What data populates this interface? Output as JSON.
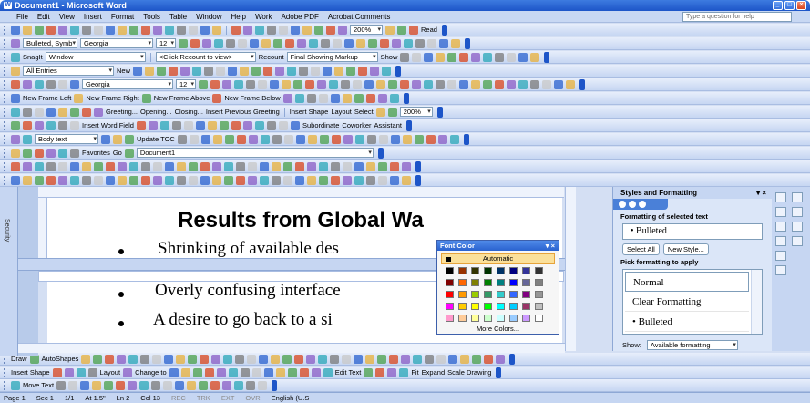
{
  "window": {
    "title": "Document1 - Microsoft Word"
  },
  "menu": [
    "File",
    "Edit",
    "View",
    "Insert",
    "Format",
    "Tools",
    "Table",
    "Window",
    "Help",
    "Work",
    "Adobe PDF",
    "Acrobat Comments"
  ],
  "ask_placeholder": "Type a question for help",
  "toolbars": {
    "standard": {
      "zoom": "200%",
      "read_label": "Read"
    },
    "formatting": {
      "style": "Bulleted, Symb",
      "font": "Georgia",
      "size": "12"
    },
    "snagit": {
      "snagit_label": "SnagIt",
      "capture_target": "Window"
    },
    "reviewing": {
      "recount": "<Click Recount to view>",
      "recount_btn": "Recount",
      "markup": "Final Showing Markup",
      "show": "Show"
    },
    "autotext": {
      "entries": "All Entries",
      "new": "New"
    },
    "format2": {
      "font": "Georgia",
      "size": "12"
    },
    "frames": {
      "items": [
        "New Frame Left",
        "New Frame Right",
        "New Frame Above",
        "New Frame Below"
      ]
    },
    "mail": {
      "items": [
        "Greeting...",
        "Opening...",
        "Closing...",
        "Insert Previous Greeting"
      ],
      "insert_shape": "Insert Shape",
      "layout": "Layout",
      "select": "Select",
      "zoom": "200%"
    },
    "fields": {
      "insert_word_field": "Insert Word Field",
      "subordinate": "Subordinate",
      "coworker": "Coworker",
      "assistant": "Assistant"
    },
    "outline": {
      "style": "Body text",
      "update_toc": "Update TOC"
    },
    "web": {
      "favorites": "Favorites",
      "go": "Go",
      "address": "Document1"
    },
    "drawing": {
      "draw": "Draw",
      "autoshapes": "AutoShapes"
    },
    "org": {
      "insert_shape": "Insert Shape",
      "layout": "Layout",
      "change_to": "Change to",
      "edit_text": "Edit Text",
      "fit": "Fit",
      "expand": "Expand",
      "scale": "Scale Drawing"
    },
    "movetext": "Move Text"
  },
  "document": {
    "heading": "Results from Global Wa",
    "bullets": [
      "Shrinking of available des",
      "Overly confusing interface",
      "A desire to go back to a si"
    ]
  },
  "font_color_popup": {
    "title": "Font Color",
    "automatic": "Automatic",
    "more": "More Colors...",
    "swatches": [
      "#000000",
      "#993300",
      "#333300",
      "#003300",
      "#003366",
      "#000080",
      "#333399",
      "#333333",
      "#800000",
      "#ff6600",
      "#808000",
      "#008000",
      "#008080",
      "#0000ff",
      "#666699",
      "#808080",
      "#ff0000",
      "#ff9900",
      "#99cc00",
      "#339966",
      "#33cccc",
      "#3366ff",
      "#800080",
      "#969696",
      "#ff00ff",
      "#ffcc00",
      "#ffff00",
      "#00ff00",
      "#00ffff",
      "#00ccff",
      "#993366",
      "#c0c0c0",
      "#ff99cc",
      "#ffcc99",
      "#ffff99",
      "#ccffcc",
      "#ccffff",
      "#99ccff",
      "#cc99ff",
      "#ffffff"
    ]
  },
  "task_pane": {
    "title": "Styles and Formatting",
    "selected_label": "Formatting of selected text",
    "selected_value": "Bulleted",
    "select_all": "Select All",
    "new_style": "New Style...",
    "pick_label": "Pick formatting to apply",
    "styles": [
      "Normal",
      "Clear Formatting",
      "Bulleted"
    ],
    "show_label": "Show:",
    "show_value": "Available formatting"
  },
  "status": {
    "page": "Page 1",
    "sec": "Sec 1",
    "pages": "1/1",
    "at": "At 1.5\"",
    "ln": "Ln 2",
    "col": "Col 13",
    "rec": "REC",
    "trk": "TRK",
    "ext": "EXT",
    "ovr": "OVR",
    "lang": "English (U.S"
  },
  "colors": {
    "title_blue": "#1d55c8",
    "toolbar": "#c6d6f2",
    "highlight": "#fbe09a"
  }
}
